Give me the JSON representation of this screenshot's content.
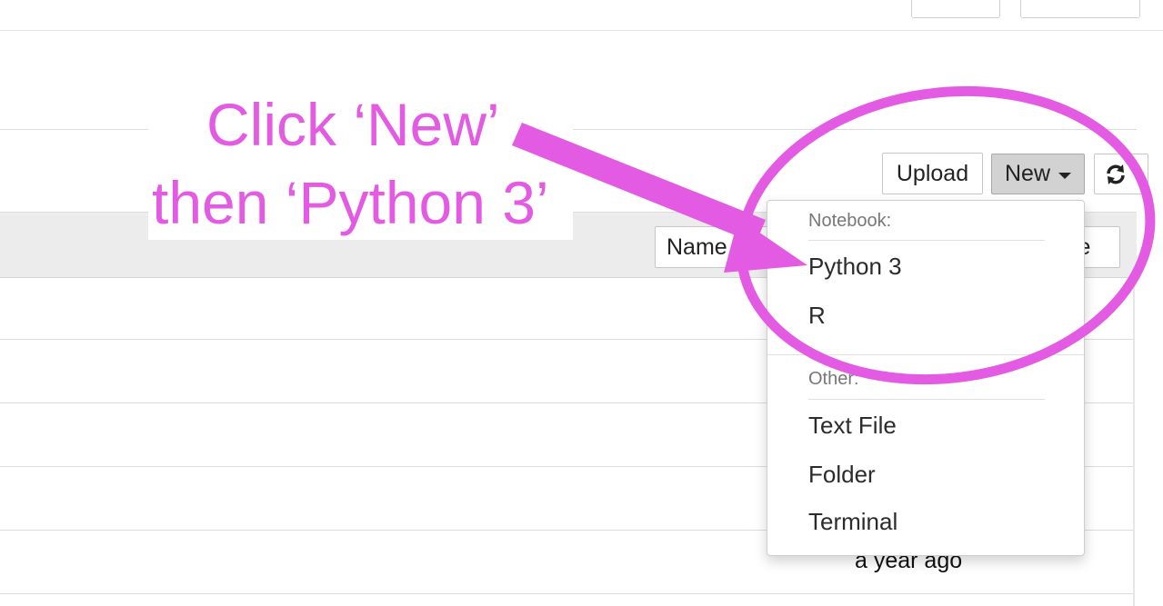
{
  "toolbar": {
    "upload_label": "Upload",
    "new_label": "New"
  },
  "list": {
    "sort_name_label": "Name",
    "sort_size_label": "ze",
    "row_modified": "a year ago"
  },
  "dropdown": {
    "notebook_header": "Notebook:",
    "items_notebook": [
      "Python 3",
      "R"
    ],
    "other_header": "Other:",
    "items_other": [
      "Text File",
      "Folder",
      "Terminal"
    ]
  },
  "annotation": {
    "line1": "Click ‘New’",
    "line2": "then ‘Python 3’",
    "color": "#e45be3"
  },
  "icons": {
    "refresh": "refresh-icon",
    "caret": "caret-down-icon"
  }
}
